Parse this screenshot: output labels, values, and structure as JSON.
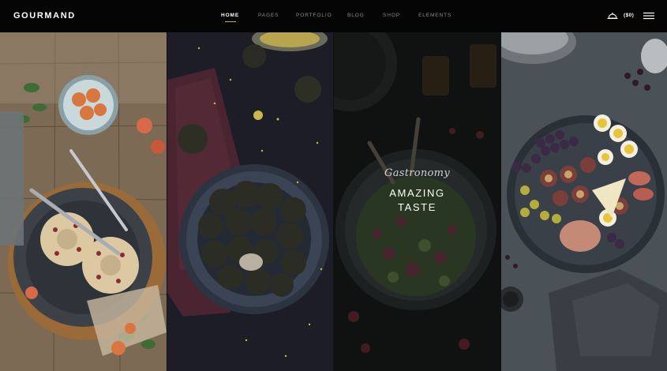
{
  "brand": {
    "logo": "GOURMAND"
  },
  "nav": {
    "items": [
      {
        "label": "HOME",
        "active": true
      },
      {
        "label": "PAGES",
        "active": false
      },
      {
        "label": "PORTFOLIO",
        "active": false
      },
      {
        "label": "BLOG",
        "active": false
      },
      {
        "label": "SHOP",
        "active": false
      },
      {
        "label": "ELEMENTS",
        "active": false
      }
    ]
  },
  "tools": {
    "cart_icon": "cloche-icon",
    "cart_total": "($0)",
    "menu_icon": "hamburger-menu-icon"
  },
  "hero": {
    "script_label": "Gastronomy",
    "headline_line1": "AMAZING",
    "headline_line2": "TASTE"
  },
  "colors": {
    "accent": "#c8a869",
    "header_bg": "#050505",
    "nav_inactive": "#8a8a8a"
  }
}
